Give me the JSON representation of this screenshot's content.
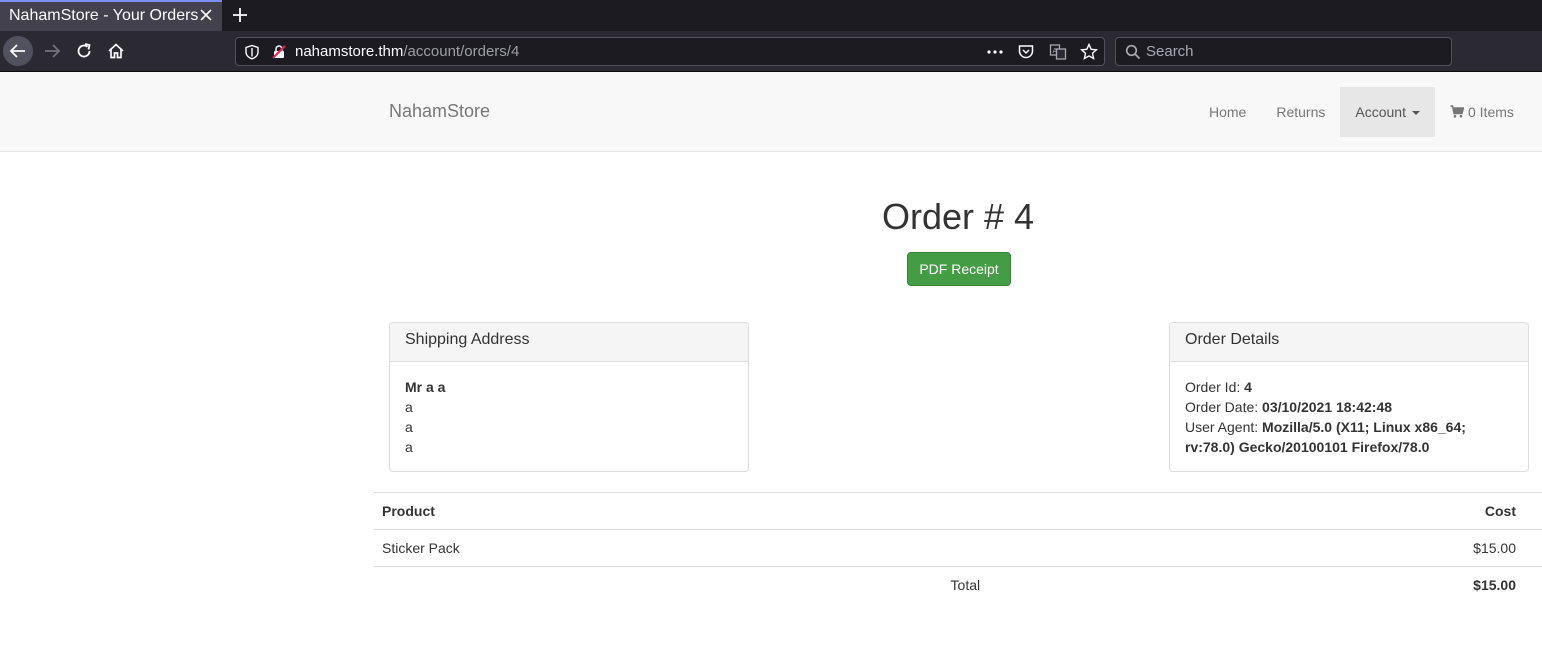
{
  "browser": {
    "tab_title": "NahamStore - Your Orders",
    "url_host": "nahamstore.thm",
    "url_path": "/account/orders/4",
    "search_placeholder": "Search"
  },
  "site": {
    "brand": "NahamStore",
    "nav": {
      "home": "Home",
      "returns": "Returns",
      "account": "Account",
      "cart": "0 Items"
    }
  },
  "order": {
    "title": "Order # 4",
    "pdf_button": "PDF Receipt",
    "shipping": {
      "heading": "Shipping Address",
      "name": "Mr a a",
      "line1": "a",
      "line2": "a",
      "line3": "a"
    },
    "details": {
      "heading": "Order Details",
      "id_label": "Order Id:",
      "id_value": "4",
      "date_label": "Order Date:",
      "date_value": "03/10/2021 18:42:48",
      "ua_label": "User Agent:",
      "ua_value": "Mozilla/5.0 (X11; Linux x86_64; rv:78.0) Gecko/20100101 Firefox/78.0"
    },
    "table": {
      "col_product": "Product",
      "col_cost": "Cost",
      "rows": [
        {
          "product": "Sticker Pack",
          "cost": "$15.00"
        }
      ],
      "total_label": "Total",
      "total_value": "$15.00"
    }
  }
}
